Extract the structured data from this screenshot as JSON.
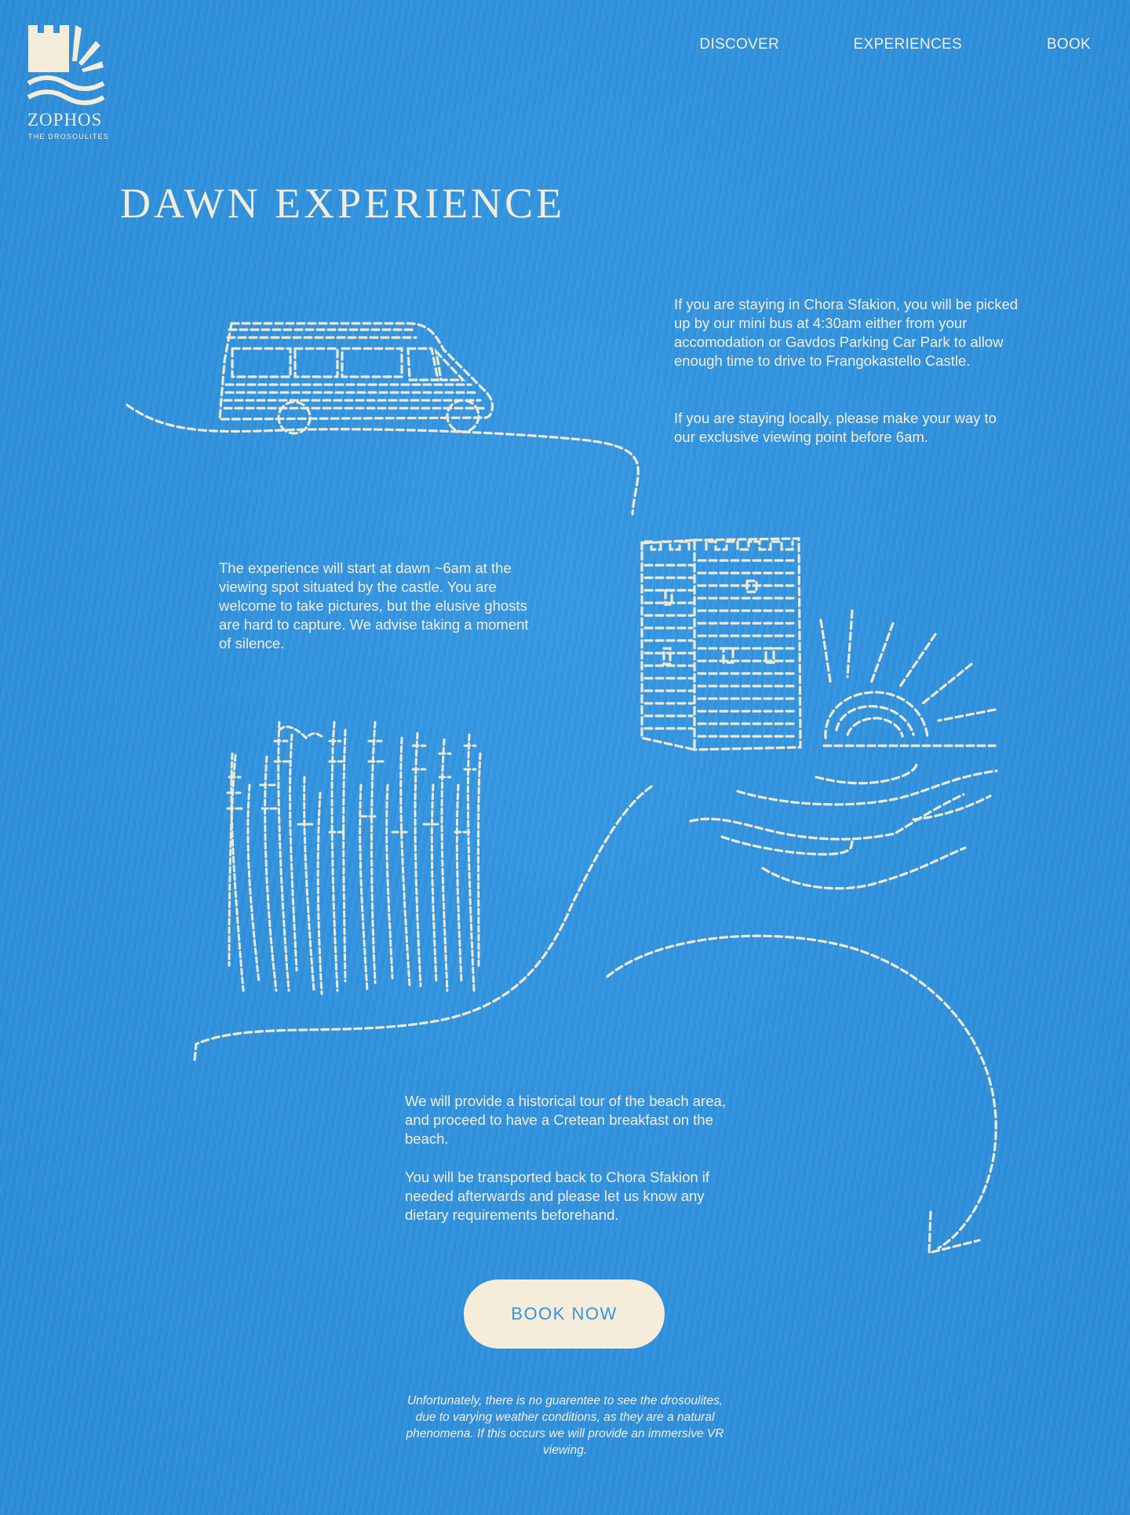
{
  "brand": {
    "name": "ZOPHOS",
    "tagline": "THE DROSOULITES",
    "logo_icon": "castle-sun-waves-logo-icon"
  },
  "nav": {
    "items": [
      {
        "label": "DISCOVER"
      },
      {
        "label": "EXPERIENCES"
      },
      {
        "label": "BOOK"
      }
    ]
  },
  "page": {
    "title": "DAWN EXPERIENCE"
  },
  "sections": {
    "pickup": {
      "p1": "If you are staying in Chora Sfakion, you will be picked up by our mini bus at 4:30am either from your accomodation or Gavdos Parking Car Park to allow enough time to drive to Frangokastello Castle.",
      "p2": "If you are staying locally, please make your way to our exclusive viewing point before 6am."
    },
    "dawn": {
      "p1": "The experience will start at dawn ~6am at the viewing spot situated by the castle. You are welcome to take pictures, but the elusive ghosts are hard to capture. We advise taking a moment of silence."
    },
    "breakfast": {
      "p1": "We will provide a historical tour of the beach area, and proceed to have a Cretean breakfast on the beach.",
      "p2": "You will be transported back to Chora Sfakion if needed afterwards and please let us know any dietary requirements beforehand."
    }
  },
  "cta": {
    "label": "BOOK NOW"
  },
  "disclaimer": "Unfortunately, there is no guarentee to see the drosoulites, due to varying weather conditions, as they are a natural phenomena. If this occurs we will provide an immersive VR viewing.",
  "illustrations": [
    "minibus-illustration",
    "castle-illustration",
    "sunrise-illustration",
    "sea-waves-illustration",
    "ghost-figures-illustration",
    "dashed-path-arrow"
  ],
  "colors": {
    "background": "#2f95e2",
    "cream": "#f4ecd8",
    "button_text": "#2f95e2"
  }
}
